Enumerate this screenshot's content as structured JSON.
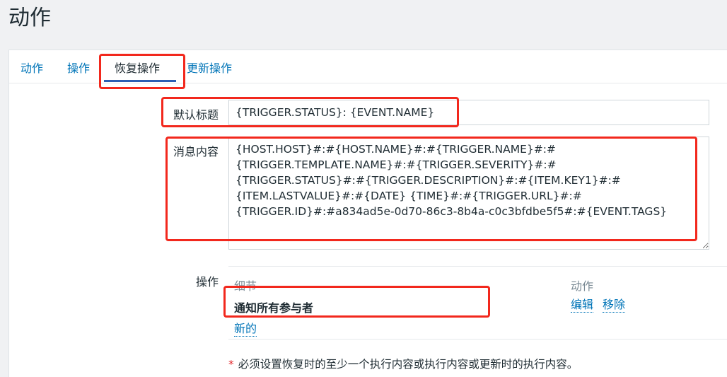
{
  "page": {
    "title": "动作"
  },
  "tabs": [
    {
      "label": "动作"
    },
    {
      "label": "操作"
    },
    {
      "label": "恢复操作"
    },
    {
      "label": "更新操作"
    }
  ],
  "form": {
    "subject_label": "默认标题",
    "subject_value": "{TRIGGER.STATUS}: {EVENT.NAME}",
    "message_label": "消息内容",
    "message_value": "{HOST.HOST}#:#{HOST.NAME}#:#{TRIGGER.NAME}#:#\n{TRIGGER.TEMPLATE.NAME}#:#{TRIGGER.SEVERITY}#:#\n{TRIGGER.STATUS}#:#{TRIGGER.DESCRIPTION}#:#{ITEM.KEY1}#:#\n{ITEM.LASTVALUE}#:#{DATE} {TIME}#:#{TRIGGER.URL}#:#\n{TRIGGER.ID}#:#a834ad5e-0d70-86c3-8b4a-c0c3bfdbe5f5#:#{EVENT.TAGS}",
    "operations_label": "操作"
  },
  "operations": {
    "col_details": "细节",
    "col_action": "动作",
    "rows": [
      {
        "details": "通知所有参与者",
        "edit_label": "编辑",
        "remove_label": "移除"
      }
    ],
    "new_label": "新的"
  },
  "note": {
    "star": "*",
    "text": "必须设置恢复时的至少一个执行内容或执行内容或更新时的执行内容。"
  },
  "colors": {
    "link": "#0275b8",
    "highlight": "#f2281d",
    "active_tab_underline": "#2b5fb4"
  }
}
